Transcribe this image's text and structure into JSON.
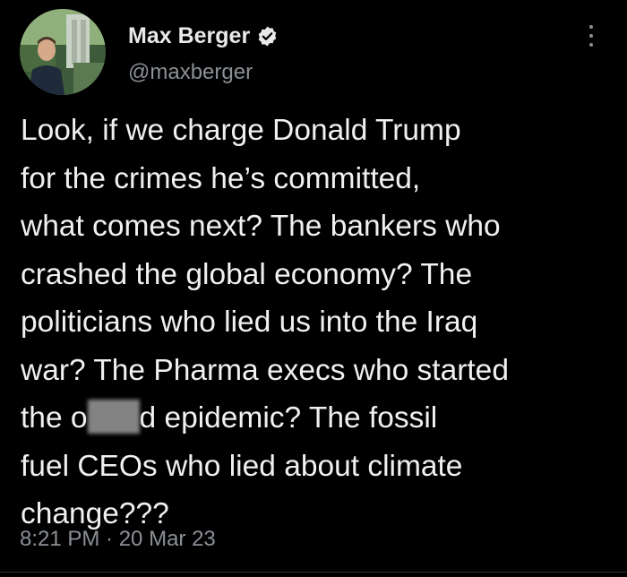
{
  "author": {
    "display_name": "Max Berger",
    "handle": "@maxberger",
    "verified": true
  },
  "tweet": {
    "lines": [
      "Look, if we charge Donald Trump",
      "for the crimes he’s committed,",
      "what comes next? The bankers who",
      "crashed the global economy? The",
      "politicians who lied us into the Iraq",
      "war? The Pharma execs who started"
    ],
    "redacted_line_before": "the o",
    "redacted_line_after": "d epidemic? The fossil",
    "lines_end": [
      "fuel CEOs who lied about climate",
      "change???"
    ]
  },
  "meta": {
    "timestamp": "8:21 PM · 20 Mar 23"
  },
  "icons": {
    "verified": "verified-badge-icon",
    "more": "more-options-icon"
  },
  "colors": {
    "background": "#000000",
    "text": "#e7e9ea",
    "muted": "#8b9096"
  }
}
